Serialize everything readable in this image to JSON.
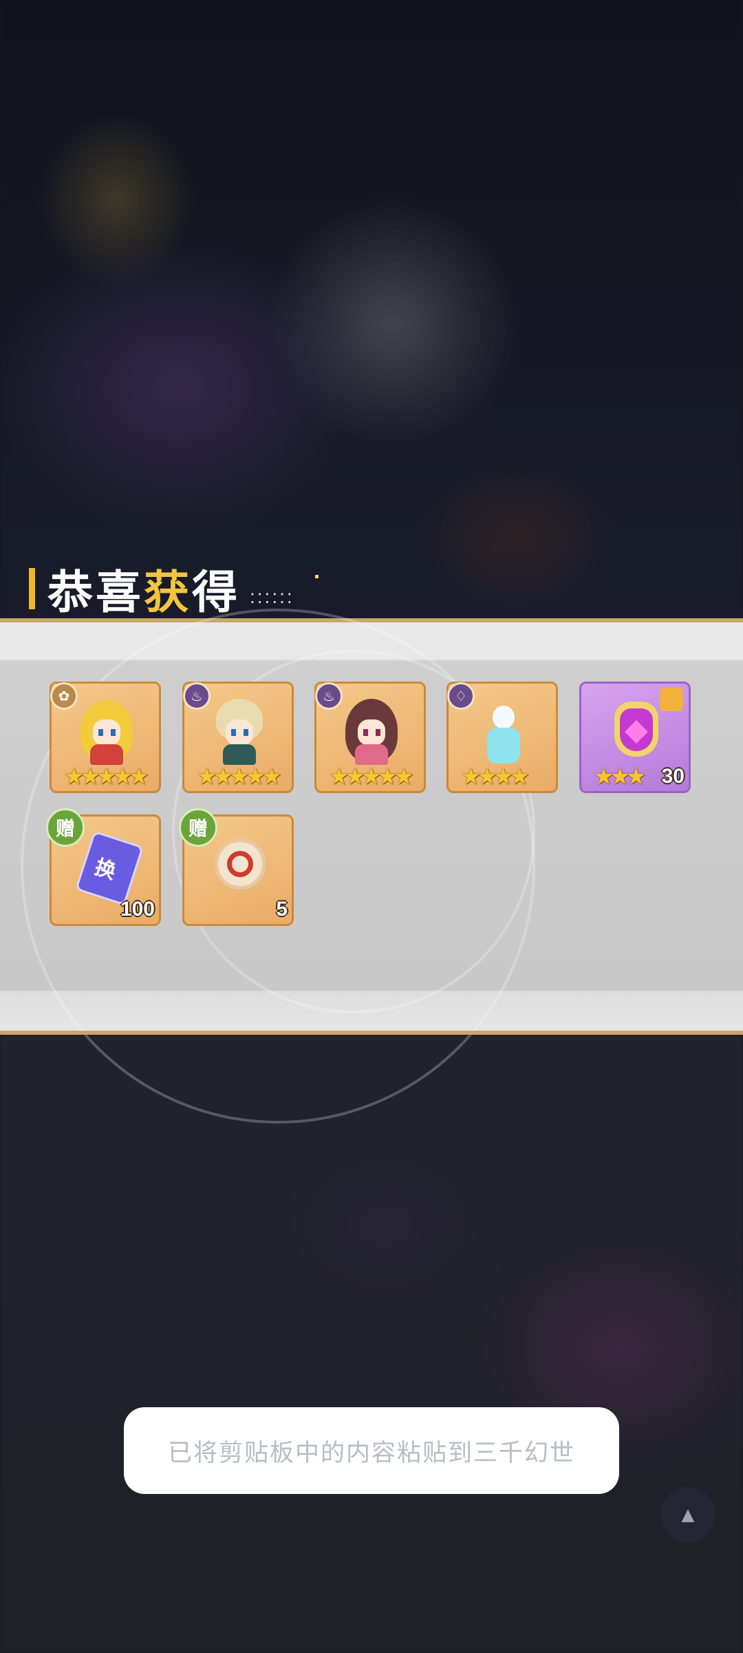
{
  "title": {
    "part1": "恭喜",
    "highlight": "获",
    "part2": "得",
    "dots": "::::::"
  },
  "rewards": [
    {
      "type": "character",
      "stars": "★★★★★",
      "faction_icon": "lotus-icon",
      "art": "yellow-hair-girl-icon"
    },
    {
      "type": "character",
      "stars": "★★★★★",
      "faction_icon": "flame-icon",
      "art": "blonde-boy-icon"
    },
    {
      "type": "character",
      "stars": "★★★★★",
      "faction_icon": "flame-icon",
      "art": "brown-hair-girl-icon"
    },
    {
      "type": "character",
      "stars": "★★★★",
      "faction_icon": "wing-icon",
      "art": "white-silhouette-icon"
    },
    {
      "type": "fragment",
      "stars": "★★★",
      "count": "30",
      "art": "purple-crest-icon"
    }
  ],
  "gifts": [
    {
      "badge": "赠",
      "symbol": "换",
      "count": "100",
      "art": "exchange-ticket-icon"
    },
    {
      "badge": "赠",
      "count": "5",
      "art": "dragon-coin-icon"
    }
  ],
  "toast": {
    "message": "已将剪贴板中的内容粘贴到三千幻世"
  },
  "colors": {
    "accent_gold": "#f3c53e",
    "panel_border": "#caa669",
    "card_orange": "#e9ac66",
    "card_purple": "#b47ad8",
    "gift_green": "#6aa53a"
  }
}
